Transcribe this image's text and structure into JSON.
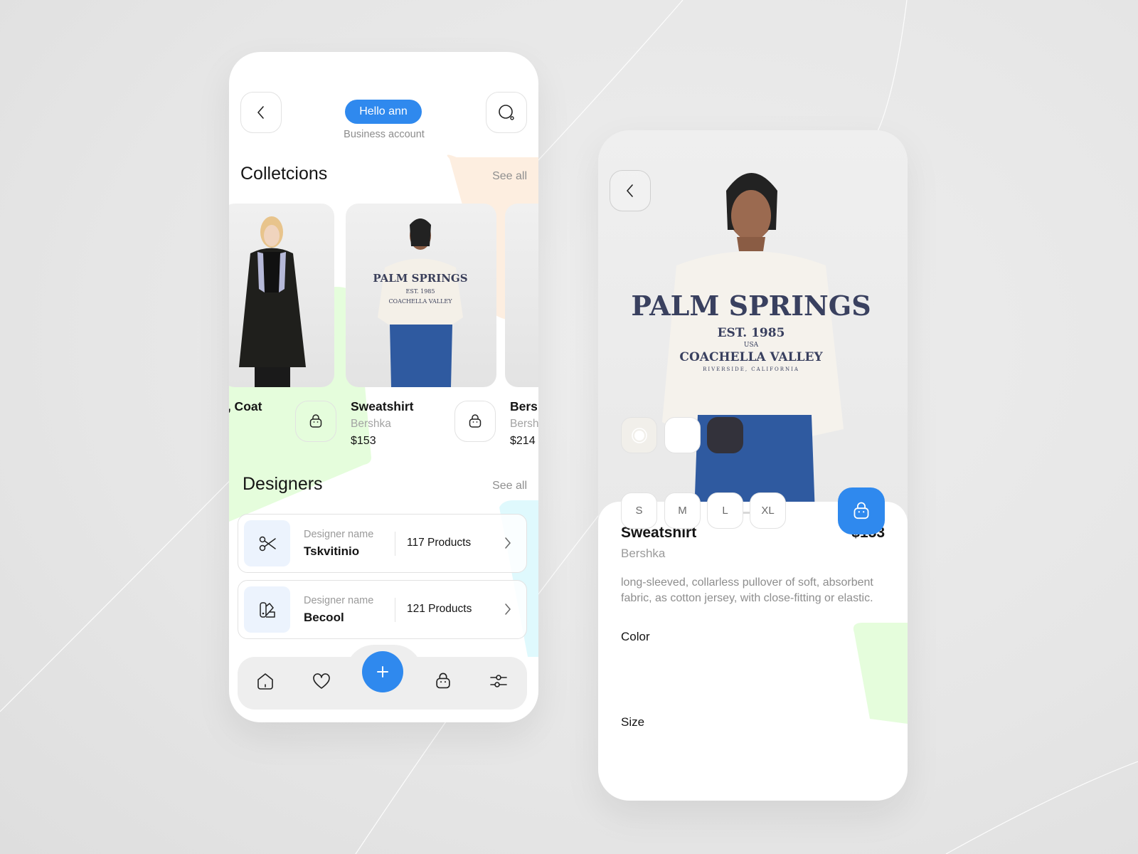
{
  "colors": {
    "accent": "#2f89ee",
    "blob_peach": "#fdeee0",
    "blob_green": "#e5fddc",
    "blob_cyan": "#dff9fd",
    "swatch_cream": "#f1efea",
    "swatch_white": "#ffffff",
    "swatch_dark": "#33323b"
  },
  "home": {
    "greeting": "Hello ann",
    "account_type": "Business account",
    "back_icon": "chevron-left-icon",
    "search_icon": "search-icon",
    "collections": {
      "title": "Colletcions",
      "see_all": "See all",
      "items": [
        {
          "name": "·, Coat",
          "brand": "",
          "price": "",
          "image": "woman-black-coat-photo"
        },
        {
          "name": "Sweatshirt",
          "brand": "Bershka",
          "price": "$153",
          "image": "woman-palm-springs-sweatshirt-photo"
        },
        {
          "name": "Bers",
          "brand": "Bersh",
          "price": "$214",
          "image": "partial-product-photo"
        }
      ]
    },
    "designers": {
      "title": "Designers",
      "see_all": "See all",
      "items": [
        {
          "label": "Designer name",
          "name": "Tskvitinio",
          "count": "117 Products",
          "icon": "scissors-icon"
        },
        {
          "label": "Designer name",
          "name": "Becool",
          "count": "121 Products",
          "icon": "swatches-icon"
        }
      ]
    },
    "nav": [
      {
        "name": "home",
        "icon": "home-icon"
      },
      {
        "name": "favorites",
        "icon": "heart-icon"
      },
      {
        "name": "add",
        "icon": "plus-icon"
      },
      {
        "name": "cart",
        "icon": "bag-icon"
      },
      {
        "name": "filters",
        "icon": "sliders-icon"
      }
    ]
  },
  "detail": {
    "back_icon": "chevron-left-icon",
    "hero_image": "woman-palm-springs-sweatshirt-photo",
    "title": "Sweatshirt",
    "price": "$153",
    "brand": "Bershka",
    "description": "long-sleeved, collarless pullover of soft, absorbent fabric, as cotton jersey, with close-fitting or elastic.",
    "color_label": "Color",
    "colors": [
      {
        "name": "cream",
        "selected": true
      },
      {
        "name": "white",
        "selected": false
      },
      {
        "name": "dark-navy",
        "selected": false
      }
    ],
    "size_label": "Size",
    "sizes": [
      "S",
      "M",
      "L",
      "XL"
    ],
    "add_to_cart_icon": "bag-icon"
  }
}
